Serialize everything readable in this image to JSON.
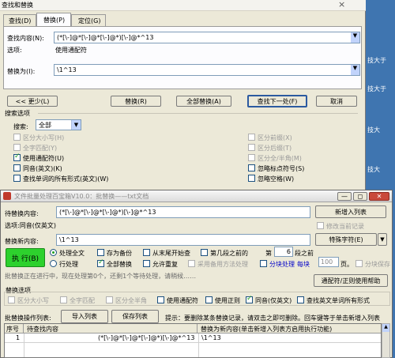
{
  "find_dialog": {
    "title": "查找和替换",
    "close_glyph": "×",
    "tabs": [
      "查找(D)",
      "替换(P)",
      "定位(G)"
    ],
    "find_label": "查找内容(N):",
    "find_value": "(*[\\-]@*[\\-]@*[\\-]@*)[\\-]@*^13",
    "options_label": "选项:",
    "options_value": "使用通配符",
    "replace_label": "替换为(I):",
    "replace_value": "\\1^13",
    "buttons": {
      "less": "<< 更少(L)",
      "replace": "替换(R)",
      "replace_all": "全部替换(A)",
      "find_next": "查找下一处(F)",
      "cancel": "取消"
    },
    "search_options_label": "搜索选项",
    "search_label": "搜索:",
    "search_value": "全部",
    "checks_left": [
      "区分大小写(H)",
      "全字匹配(Y)",
      "使用通配符(U)",
      "同音(英文)(K)",
      "查找单词的所有形式(英文)(W)"
    ],
    "checks_right": [
      "区分前缀(X)",
      "区分后缀(T)",
      "区分全/半角(M)",
      "忽略标点符号(S)",
      "忽略空格(W)"
    ],
    "side_text": [
      "技大于",
      "技大于",
      "技大",
      "技大",
      "技大"
    ]
  },
  "tool_window": {
    "title": "文件批量处理百宝箱V10.0：批替换——txt文档",
    "title_buttons": [
      "—",
      "◻",
      "✕"
    ],
    "pending_label": "待替换内容:",
    "pending_value": "(*[\\-]@*[\\-]@*[\\-]@*)[\\-]@*^13",
    "add_button": "新增入列表",
    "modify_label": "修改当前记录",
    "option_text": "选项:同音(仅英文)",
    "new_content_label": "替换新内容:",
    "new_content_value": "\\1^13",
    "special_char_button": "特殊字符(E)",
    "execute_button": "执 行(B)",
    "radio_row1": [
      "处理全文",
      "存为备份",
      "从末尾开始查",
      "第几段之前的",
      "第",
      "6",
      "段之前"
    ],
    "radio_row2": [
      "行处理",
      "全部替换",
      "允许重复",
      "采用备用方法处理",
      "分块处理",
      "每块",
      "100",
      "页。",
      "分块保存"
    ],
    "status_text": "批替换正在进行中，现在处理第0个，还剩1个等待处理，请稍候……",
    "regex_help_button": "通配符/正则使用帮助",
    "options_group_label": "替换选项",
    "options_checks": [
      "区分大小写",
      "全字匹配",
      "区分全半角",
      "使用通配符",
      "使用正则",
      "同音(仅英文)",
      "查找英文单词所有形式"
    ],
    "list_label": "批替换操作列表:",
    "import_button": "导入列表",
    "save_button": "保存列表",
    "hint": "提示：要删除某条替换记录，请双击之即可删除。回车键等于单击新增入列表",
    "table": {
      "headers": [
        "序号",
        "待查找内容",
        "替换为新内容(单击新增入列表方启用执行功能)"
      ],
      "rows": [
        [
          "1",
          "(*[\\-]@*[\\-]@*[\\-]@*)[\\-]@*^13",
          "\\1^13"
        ]
      ]
    }
  }
}
